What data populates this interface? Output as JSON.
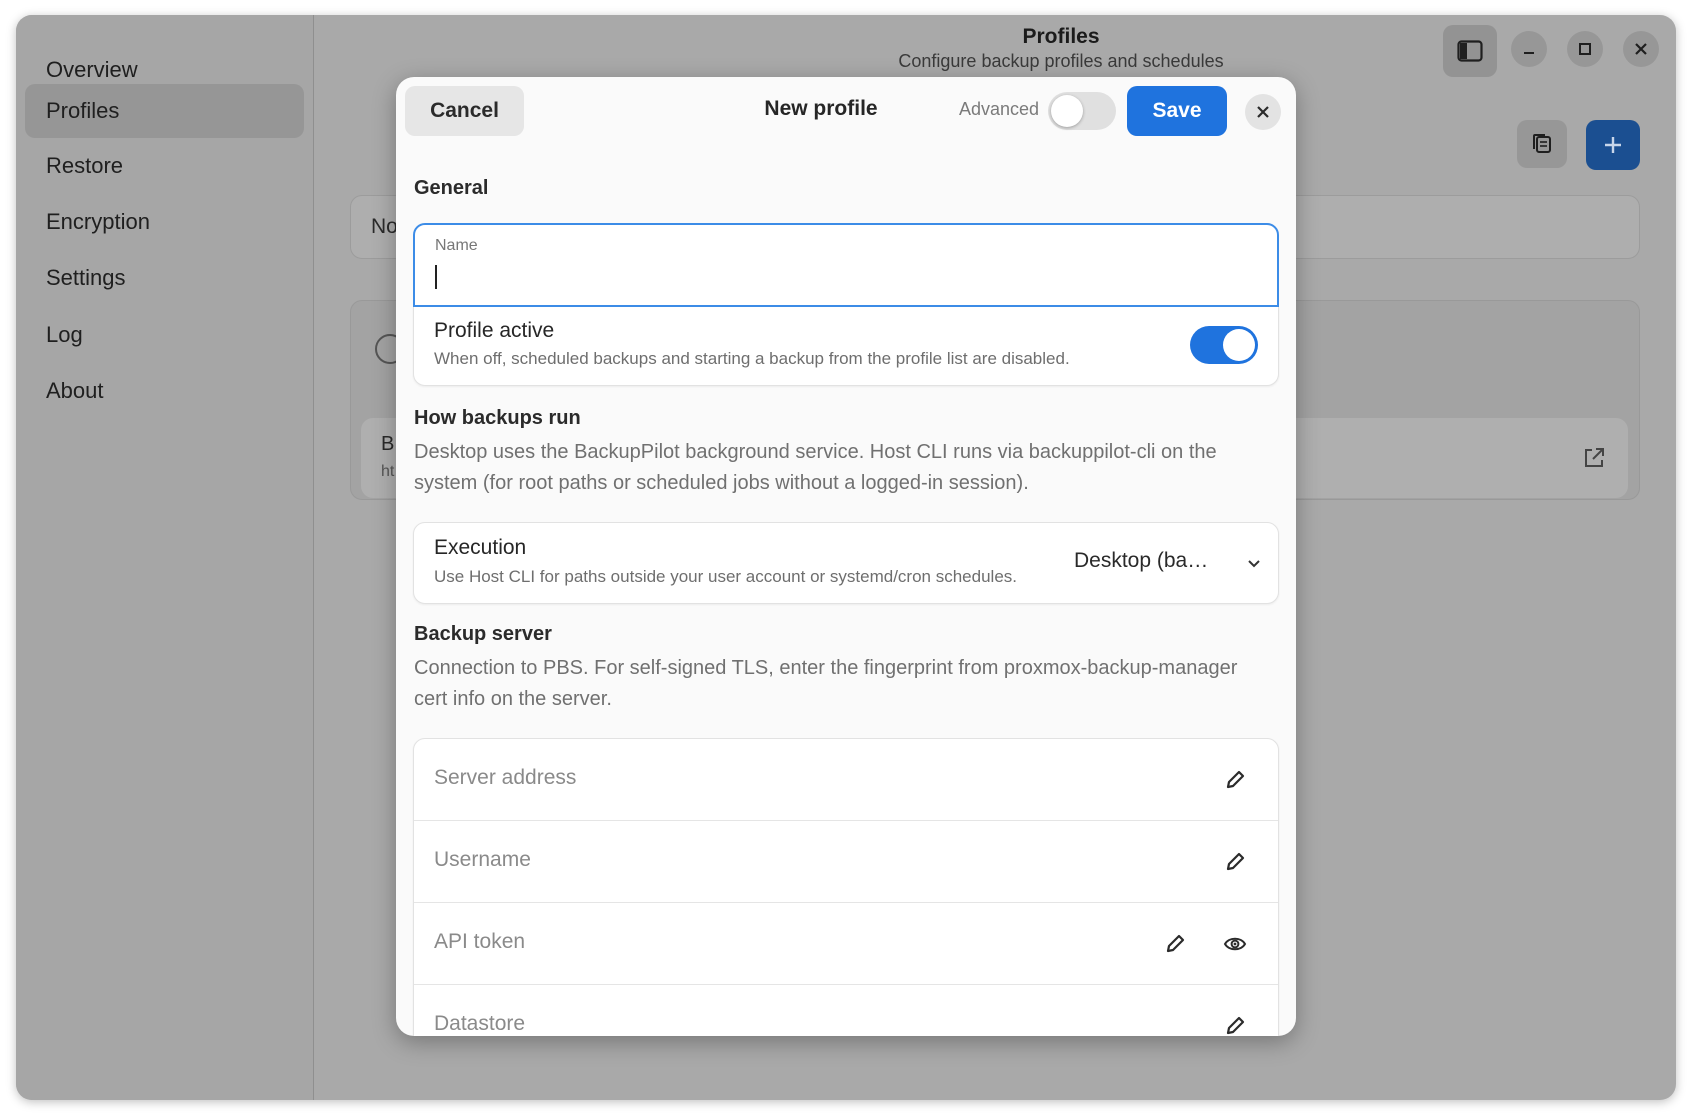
{
  "sidebar": {
    "items": [
      {
        "label": "Overview"
      },
      {
        "label": "Profiles"
      },
      {
        "label": "Restore"
      },
      {
        "label": "Encryption"
      },
      {
        "label": "Settings"
      },
      {
        "label": "Log"
      },
      {
        "label": "About"
      }
    ],
    "active": "Profiles"
  },
  "header": {
    "title": "Profiles",
    "subtitle": "Configure backup profiles and schedules"
  },
  "background": {
    "card_text_1": "No",
    "card_text_2": "B",
    "card_text_3": "ht"
  },
  "dialog": {
    "cancel_label": "Cancel",
    "title": "New profile",
    "advanced_label": "Advanced",
    "advanced_on": false,
    "save_label": "Save",
    "general": {
      "title": "General",
      "name_label": "Name",
      "name_value": "",
      "profile_active_title": "Profile active",
      "profile_active_subtitle": "When off, scheduled backups and starting a backup from the profile list are disabled.",
      "profile_active_on": true
    },
    "how_backups_run": {
      "title": "How backups run",
      "description": "Desktop uses the BackupPilot background service. Host CLI runs via backuppilot-cli on the system (for root paths or scheduled jobs without a logged-in session).",
      "execution_title": "Execution",
      "execution_subtitle": "Use Host CLI for paths outside your user account or systemd/cron schedules.",
      "execution_value": "Desktop (ba…"
    },
    "backup_server": {
      "title": "Backup server",
      "description": "Connection to PBS. For self-signed TLS, enter the fingerprint from proxmox-backup-manager cert info on the server.",
      "fields": [
        {
          "placeholder": "Server address"
        },
        {
          "placeholder": "Username"
        },
        {
          "placeholder": "API token"
        },
        {
          "placeholder": "Datastore"
        }
      ]
    }
  },
  "colors": {
    "accent": "#1f73de",
    "focus_border": "#3c8ce7",
    "window_dimmed": "#a9a9a9"
  }
}
